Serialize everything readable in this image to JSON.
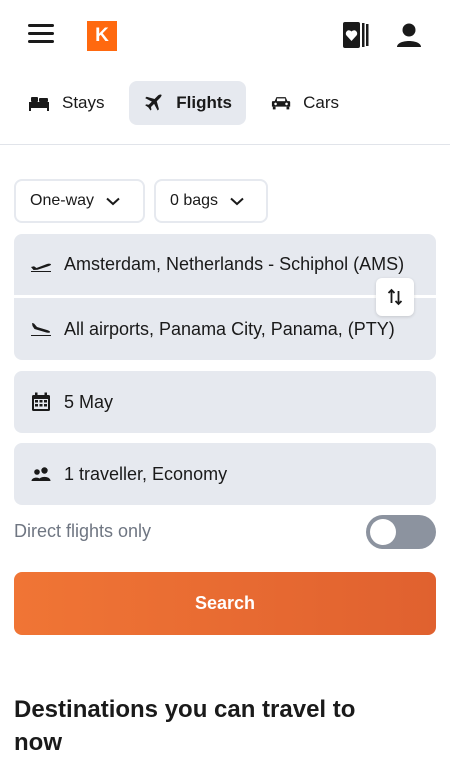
{
  "header": {
    "logo_letter": "K",
    "menu_icon": "hamburger-menu-icon",
    "trips_icon": "trips-book-icon",
    "account_icon": "account-icon"
  },
  "tabs": [
    {
      "label": "Stays",
      "icon": "bed-icon",
      "active": false
    },
    {
      "label": "Flights",
      "icon": "airplane-icon",
      "active": true
    },
    {
      "label": "Cars",
      "icon": "car-icon",
      "active": false
    }
  ],
  "trip_type": {
    "value": "One-way"
  },
  "bags": {
    "value": "0 bags"
  },
  "origin": {
    "value": "Amsterdam, Netherlands - Schiphol (AMS)"
  },
  "destination": {
    "value": "All airports, Panama City, Panama, (PTY)"
  },
  "date": {
    "value": "5 May"
  },
  "travellers": {
    "value": "1 traveller, Economy"
  },
  "direct_flights": {
    "label": "Direct flights only",
    "enabled": false
  },
  "search_button": {
    "label": "Search"
  },
  "destinations_heading": "Destinations you can travel to now",
  "colors": {
    "brand": "#ff690f",
    "accent": "#e96a31",
    "field_bg": "#e6e9ef"
  }
}
